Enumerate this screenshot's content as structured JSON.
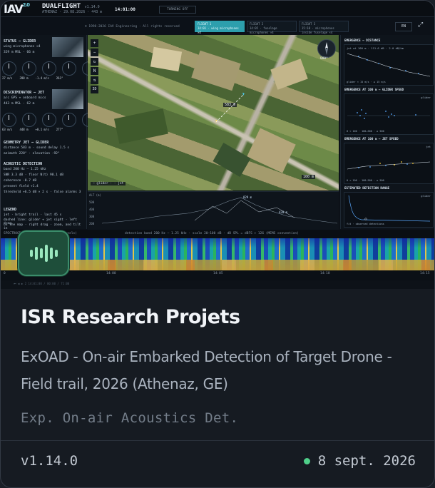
{
  "screenshot": {
    "logo": "IAV",
    "logo_suffix": "2.0",
    "app_name": "DUALFLIGHT",
    "app_version": "v1.14.0",
    "location_line": "ATHENAZ · 29.08.2026 · 443 m",
    "clock": "14:01:00",
    "turning_status": "TURNING OFF",
    "copyright": "© 1998-2026 IAV Engineering · All rights reserved",
    "flight_tabs": [
      {
        "label": "FLIGHT 1",
        "sub": "14:01 · wing microphones ×4"
      },
      {
        "label": "FLIGHT 2",
        "sub": "14:05 · fuselage microphones ×4"
      },
      {
        "label": "FLIGHT 3",
        "sub": "15:10 · microphones inside fuselage ×4"
      }
    ],
    "language": "EN",
    "left_panel": {
      "glider_title": "STATUS — GLIDER",
      "glider_lines": [
        "wing microphones ×4",
        "329 m MSL  ·  66 m"
      ],
      "glider_dials": [
        "27 m/s",
        "398 m",
        "-1.4 m/s",
        "261°"
      ],
      "jet_title": "DISCRIMINATOR — JET",
      "jet_lines": [
        "a/c GPS + onboard mics",
        "443 m MSL  ·  62 m"
      ],
      "jet_dials": [
        "63 m/s",
        "448 m",
        "+0.1 m/s",
        "277°"
      ],
      "geometry_title": "GEOMETRY JET — GLIDER",
      "geometry_lines": [
        "distance 583 m  ·  sound delay 1.5 s",
        "azimuth 228°  ·  elevation -92°"
      ],
      "acoustic_title": "ACOUSTIC DETECTION",
      "acoustic_lines": [
        "band 200 Hz – 1.25 kHz",
        "SNR 3.3 dB  ·  floor N(t) 98.1 dB",
        "coherence -0.7 dB",
        "present field +1.4",
        "threshold +6.5 dB × 2 s · false alarms 3"
      ],
      "legend_title": "LEGEND",
      "legend_lines": [
        "jet · bright trail · last 45 s",
        "dashed line: glider + jet sight · left drag",
        "on the map · right drag · zoom, and tilt in"
      ]
    },
    "map": {
      "controls": [
        "+",
        "−",
        "↻",
        "N",
        "⇅",
        "3D"
      ],
      "compass_value": "000°",
      "distance_label": "583 m",
      "scale_label": "100 m",
      "legend": "— glider · · jet",
      "altitude_label": "ALT (m)",
      "altitude_ticks": [
        "500",
        "400",
        "300",
        "200"
      ],
      "altitude_marker": "829 m",
      "altitude_marker2": "420 m"
    },
    "right_panel": [
      {
        "title": "EMERGENCE — DISTANCE",
        "note": "jet at 100 m  ·  111.6 dB  ·  2.0 dB/km"
      },
      {
        "title": "EMERGENCE AT 100 m — GLIDER SPEED",
        "note": "glider"
      },
      {
        "title": "EMERGENCE AT 100 m — JET SPEED",
        "note": "jet"
      },
      {
        "title": "ESTIMATED DETECTION RANGE",
        "note": "glider"
      }
    ],
    "right_legends": [
      "glider < 15 m/s  ·  ≥ 15 m/s",
      "0 < 100  ·  100–500  ·  ≥ 500",
      "0 < 100  ·  100–500  ·  ≥ 500",
      "fit  ·  observed detections"
    ],
    "spectrogram_header": "SPECTROGRAM  ·  spectrogram (4 channels)",
    "spectrogram_info": "detection band 200 Hz – 1.25 kHz  ·  scale 20–100 dB  ·  dB SPL = dBFS + 126 (MEMS convention)",
    "time_ticks": [
      "0",
      "14:00",
      "14:05",
      "14:10",
      "14:15"
    ],
    "footer_hint": "⏮  ◀  ▶  2  14:01:00 / 00:00 / 71:00"
  },
  "card": {
    "title": "ISR Research Projets",
    "description": "ExOAD - On-air Embarked Detection of Target Drone - Field trail, 2026 (Athenaz, GE)",
    "tagline": "Exp. On-air Acoustics Det.",
    "version": "v1.14.0",
    "date": "8 sept. 2026",
    "status_color": "#4fd08a",
    "icon": "audio-waveform-icon"
  }
}
